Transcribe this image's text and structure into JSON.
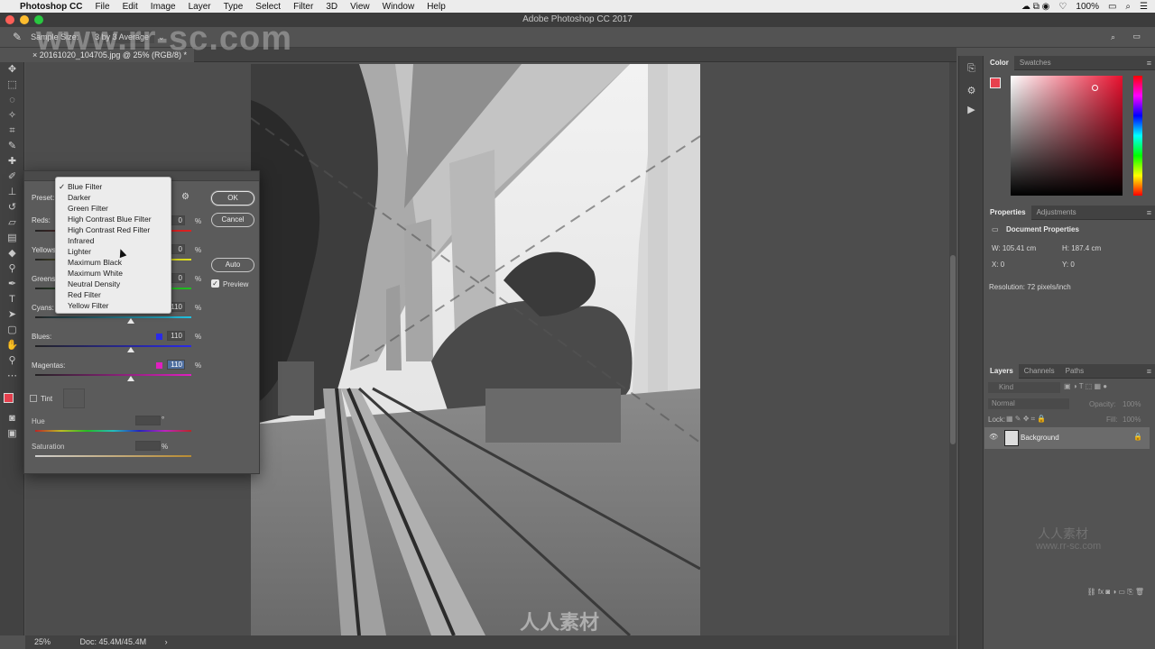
{
  "menubar": {
    "app_name": "Photoshop CC",
    "items": [
      "File",
      "Edit",
      "Image",
      "Layer",
      "Type",
      "Select",
      "Filter",
      "3D",
      "View",
      "Window",
      "Help"
    ],
    "battery": "100%",
    "time_icons": "☁ ⧉ ◉"
  },
  "window": {
    "title": "Adobe Photoshop CC 2017"
  },
  "options_bar": {
    "sample_size_label": "Sample Size:",
    "sample_size_value": "3 by 3 Average"
  },
  "document": {
    "tab_label": "20161020_104705.jpg @ 25% (RGB/8) *",
    "zoom": "25%",
    "doc_size": "Doc: 45.4M/45.4M"
  },
  "dialog": {
    "preset_label": "Preset:",
    "ok_label": "OK",
    "cancel_label": "Cancel",
    "auto_label": "Auto",
    "preview_label": "Preview",
    "preview_checked": true,
    "rows": [
      {
        "label": "Reds:",
        "value": "0",
        "pct": "%",
        "color": "#e02020"
      },
      {
        "label": "Yellows:",
        "value": "0",
        "pct": "%",
        "color": "#e0e020"
      },
      {
        "label": "Greens:",
        "value": "0",
        "pct": "%",
        "color": "#20c020"
      },
      {
        "label": "Cyans:",
        "value": "110",
        "pct": "%",
        "color": "#20c0e0"
      },
      {
        "label": "Blues:",
        "value": "110",
        "pct": "%",
        "color": "#2a2ae8"
      },
      {
        "label": "Magentas:",
        "value": "110",
        "pct": "%",
        "color": "#e020c0"
      }
    ],
    "tint_label": "Tint",
    "hue_label": "Hue",
    "hue_unit": "°",
    "saturation_label": "Saturation",
    "saturation_unit": "%"
  },
  "preset_menu": {
    "selected": "Blue Filter",
    "options": [
      "Blue Filter",
      "Darker",
      "Green Filter",
      "High Contrast Blue Filter",
      "High Contrast Red Filter",
      "Infrared",
      "Lighter",
      "Maximum Black",
      "Maximum White",
      "Neutral Density",
      "Red Filter",
      "Yellow Filter"
    ]
  },
  "color_panel": {
    "tabs": [
      "Color",
      "Swatches"
    ],
    "fg_color": "#e8404e"
  },
  "properties_panel": {
    "tabs": [
      "Properties",
      "Adjustments"
    ],
    "heading": "Document Properties",
    "w": "W:  105.41 cm",
    "h": "H:  187.4 cm",
    "x": "X:  0",
    "y": "Y:  0",
    "resolution": "Resolution: 72 pixels/inch"
  },
  "layers_panel": {
    "tabs": [
      "Layers",
      "Channels",
      "Paths"
    ],
    "kind_placeholder": "Kind",
    "blend_mode": "Normal",
    "opacity_label": "Opacity:",
    "opacity_value": "100%",
    "lock_label": "Lock:",
    "fill_label": "Fill:",
    "fill_value": "100%",
    "layer_name": "Background"
  },
  "watermark": {
    "top": "www.rr-sc.com",
    "cn": "人人素材",
    "sub": "www.rr-sc.com"
  }
}
